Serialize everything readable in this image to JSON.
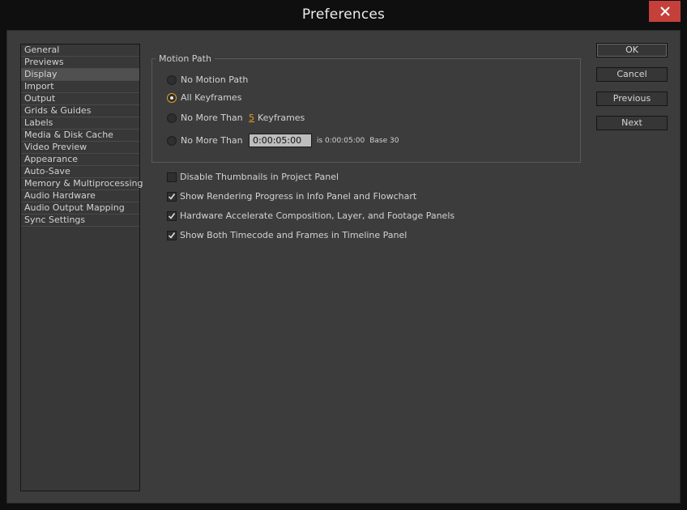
{
  "window": {
    "title": "Preferences",
    "close_glyph": "✕"
  },
  "sidebar": {
    "items": [
      {
        "label": "General",
        "selected": false
      },
      {
        "label": "Previews",
        "selected": false
      },
      {
        "label": "Display",
        "selected": true
      },
      {
        "label": "Import",
        "selected": false
      },
      {
        "label": "Output",
        "selected": false
      },
      {
        "label": "Grids & Guides",
        "selected": false
      },
      {
        "label": "Labels",
        "selected": false
      },
      {
        "label": "Media & Disk Cache",
        "selected": false
      },
      {
        "label": "Video Preview",
        "selected": false
      },
      {
        "label": "Appearance",
        "selected": false
      },
      {
        "label": "Auto-Save",
        "selected": false
      },
      {
        "label": "Memory & Multiprocessing",
        "selected": false
      },
      {
        "label": "Audio Hardware",
        "selected": false
      },
      {
        "label": "Audio Output Mapping",
        "selected": false
      },
      {
        "label": "Sync Settings",
        "selected": false
      }
    ]
  },
  "motion_path": {
    "title": "Motion Path",
    "options": [
      {
        "label": "No Motion Path",
        "checked": false
      },
      {
        "label": "All Keyframes",
        "checked": true
      },
      {
        "label": "No More Than",
        "checked": false,
        "value": "5",
        "suffix": "Keyframes"
      },
      {
        "label": "No More Than",
        "checked": false,
        "value": "0:00:05:00",
        "info": "is 0:00:05:00",
        "base": "Base 30"
      }
    ]
  },
  "checkboxes": [
    {
      "label": "Disable Thumbnails in Project Panel",
      "checked": false
    },
    {
      "label": "Show Rendering Progress in Info Panel and Flowchart",
      "checked": true
    },
    {
      "label": "Hardware Accelerate Composition, Layer, and Footage Panels",
      "checked": true
    },
    {
      "label": "Show Both Timecode and Frames in Timeline Panel",
      "checked": true
    }
  ],
  "buttons": {
    "ok": "OK",
    "cancel": "Cancel",
    "previous": "Previous",
    "next": "Next"
  },
  "colors": {
    "accent": "#e0a020",
    "close_button": "#c5403a",
    "panel": "#3c3c3c"
  }
}
